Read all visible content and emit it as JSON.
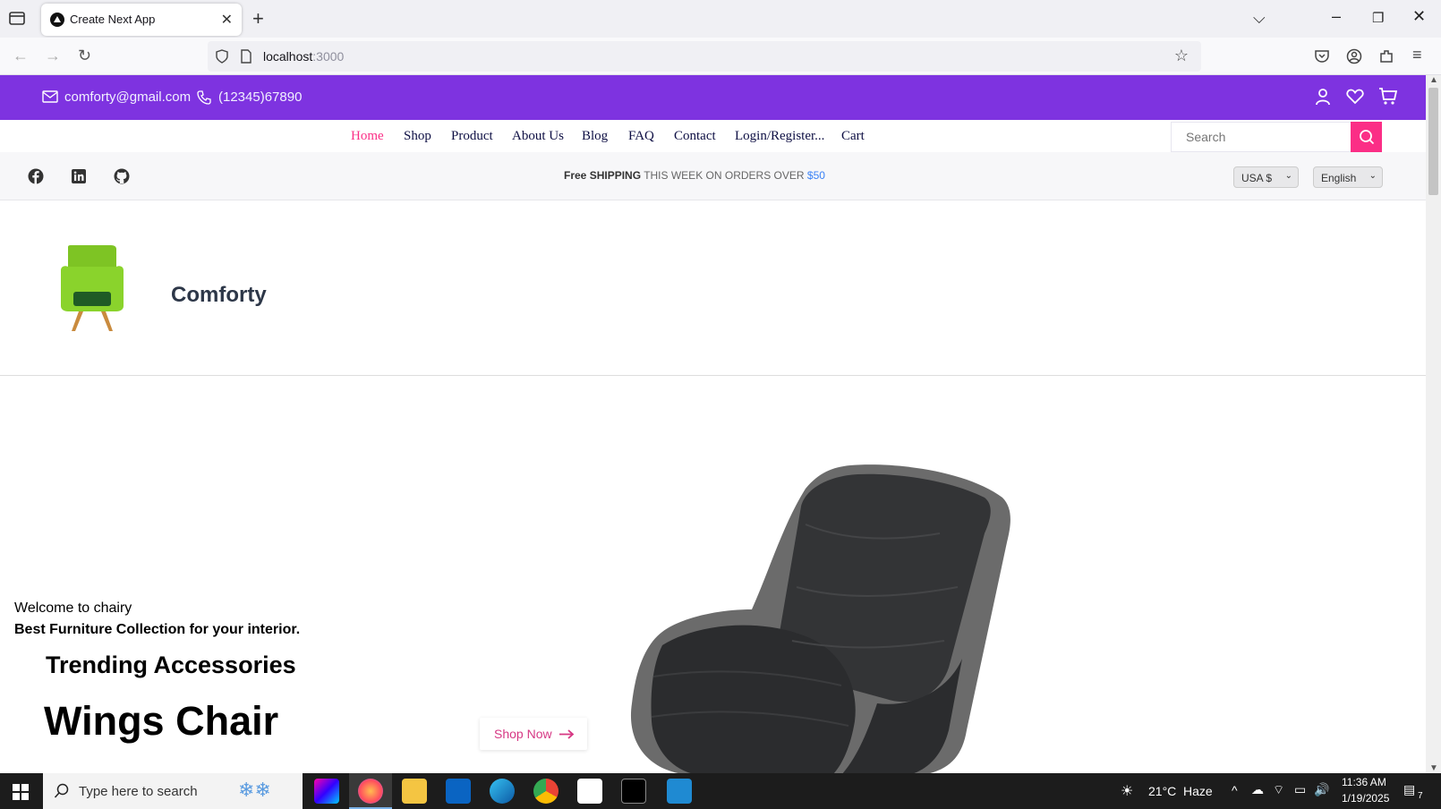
{
  "browser": {
    "tab_title": "Create Next App",
    "url_host": "localhost",
    "url_port": ":3000"
  },
  "topbar": {
    "email": "comforty@gmail.com",
    "phone": "(12345)67890"
  },
  "nav": {
    "links": [
      "Home",
      "Shop",
      "Product",
      "About Us",
      "Blog",
      "FAQ",
      "Contact",
      "Login/Register...",
      "Cart"
    ],
    "search_placeholder": "Search"
  },
  "subbar": {
    "promo_free": "Free",
    "promo_shipping": "SHIPPING",
    "promo_middle": "THIS WEEK ON ORDERS OVER",
    "promo_price": "$50",
    "currency": "USA $",
    "language": "English"
  },
  "brand": {
    "name": "Comforty"
  },
  "hero": {
    "welcome": "Welcome to chairy",
    "subtitle": "Best Furniture Collection for your interior.",
    "trending": "Trending Accessories",
    "title": "Wings Chair",
    "cta": "Shop Now"
  },
  "taskbar": {
    "search_placeholder": "Type here to search",
    "weather": "21°C",
    "weather_desc": "Haze",
    "time": "11:36 AM",
    "date": "1/19/2025",
    "notification_count": "7"
  },
  "colors": {
    "topbar": "#7e33e0",
    "accent_pink": "#fb2e86",
    "nav_text": "#0d0e43"
  }
}
